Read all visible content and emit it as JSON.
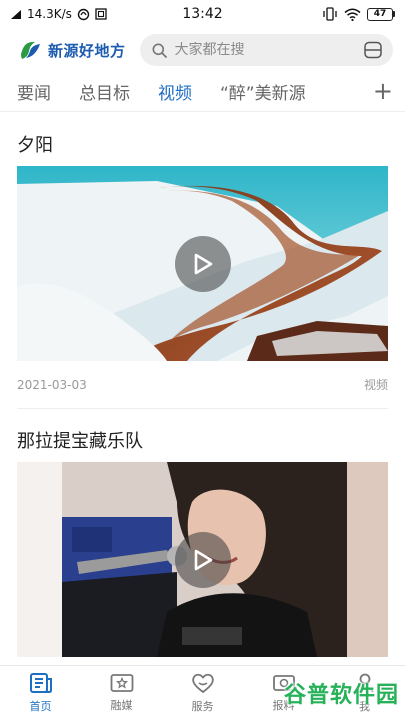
{
  "status_bar": {
    "network_speed": "14.3K/s",
    "time": "13:42",
    "battery": "47"
  },
  "header": {
    "brand": "新源好地方",
    "search_placeholder": "大家都在搜"
  },
  "tabs": [
    {
      "label": "要闻"
    },
    {
      "label": "总目标"
    },
    {
      "label": "视频",
      "active": true
    },
    {
      "label": "“醉”美新源"
    }
  ],
  "tab_add": "+",
  "feed": [
    {
      "title": "夕阳",
      "date": "2021-03-03",
      "category": "视频"
    },
    {
      "title": "那拉提宝藏乐队"
    }
  ],
  "bottom_nav": [
    {
      "label": "首页",
      "icon": "home-doc-icon",
      "active": true
    },
    {
      "label": "融媒",
      "icon": "media-star-icon"
    },
    {
      "label": "服务",
      "icon": "service-heart-icon"
    },
    {
      "label": "报料",
      "icon": "report-icon"
    },
    {
      "label": "我",
      "icon": "profile-icon"
    }
  ],
  "watermark": "谷普软件园",
  "colors": {
    "accent": "#1e6fc4",
    "brand": "#1c5bb0",
    "watermark": "#27b25a"
  }
}
